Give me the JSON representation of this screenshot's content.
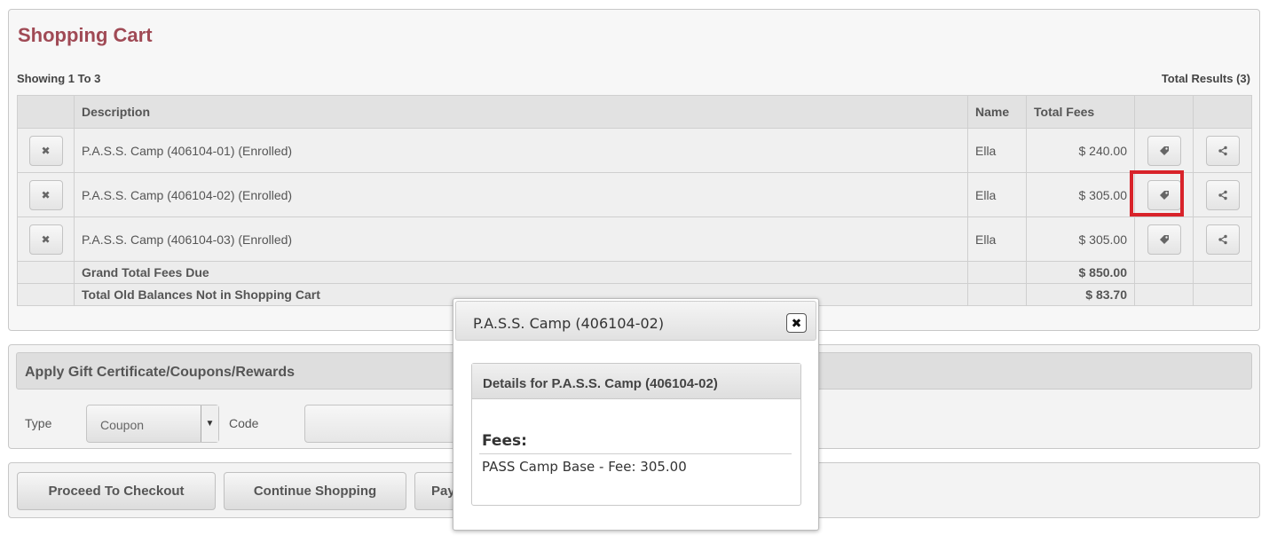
{
  "cart": {
    "title": "Shopping Cart",
    "showing": "Showing 1 To 3",
    "total_results": "Total Results (3)",
    "columns": {
      "description": "Description",
      "name": "Name",
      "total_fees": "Total Fees"
    },
    "rows": [
      {
        "description": "P.A.S.S. Camp (406104-01) (Enrolled)",
        "name": "Ella",
        "fee": "$ 240.00"
      },
      {
        "description": "P.A.S.S. Camp (406104-02) (Enrolled)",
        "name": "Ella",
        "fee": "$ 305.00"
      },
      {
        "description": "P.A.S.S. Camp (406104-03) (Enrolled)",
        "name": "Ella",
        "fee": "$ 305.00"
      }
    ],
    "grand_total_label": "Grand Total Fees Due",
    "grand_total_value": "$ 850.00",
    "old_balance_label": "Total Old Balances Not in Shopping Cart",
    "old_balance_value": "$ 83.70",
    "remove_glyph": "✖",
    "icons": {
      "remove": "x-icon",
      "fees": "tag-icon",
      "share": "share-icon"
    },
    "highlight_color": "#d8232a"
  },
  "gift": {
    "title": "Apply Gift Certificate/Coupons/Rewards",
    "type_label": "Type",
    "type_value": "Coupon",
    "code_label": "Code",
    "code_value": ""
  },
  "actions": {
    "checkout": "Proceed To Checkout",
    "continue": "Continue Shopping",
    "pay": "Pay"
  },
  "popup": {
    "title": "P.A.S.S. Camp (406104-02)",
    "close_glyph": "✖",
    "details_title": "Details for P.A.S.S. Camp (406104-02)",
    "fees_title": "Fees:",
    "fee_item": "PASS Camp Base - Fee: 305.00"
  },
  "colors": {
    "title": "#a04a55",
    "panel_bg": "#f3f3f3"
  }
}
